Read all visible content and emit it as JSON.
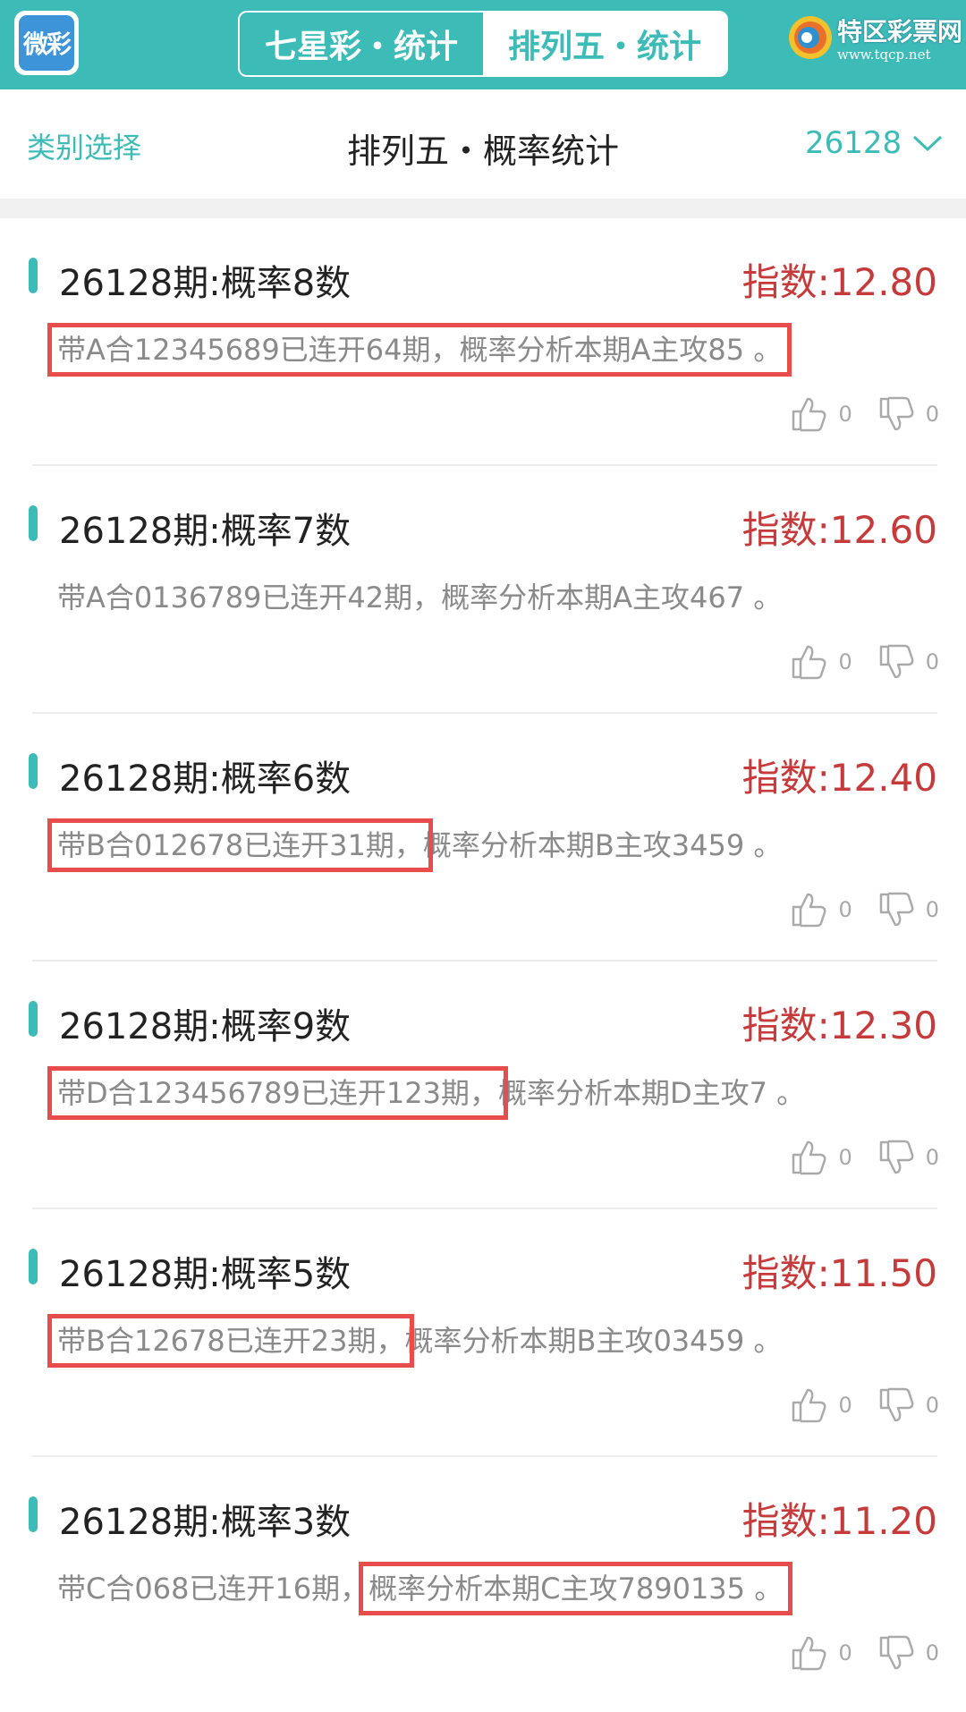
{
  "header": {
    "app_logo_text": "微彩",
    "tabs": [
      {
        "label": "七星彩・统计",
        "active": false
      },
      {
        "label": "排列五・统计",
        "active": true
      }
    ],
    "brand_name": "特区彩票网",
    "brand_url": "www.tqcp.net"
  },
  "subheader": {
    "category_label": "类别选择",
    "title": "排列五・概率统计",
    "period": "26128"
  },
  "colors": {
    "accent": "#3dbbb7",
    "index_red": "#c53a3a",
    "highlight": "#e84c4c"
  },
  "items": [
    {
      "title": "26128期:概率8数",
      "index": "指数:12.80",
      "desc_a": "带A合12345689已连开64期，概率分析本期A主攻85 。",
      "desc_b": "",
      "likes": "0",
      "dislikes": "0"
    },
    {
      "title": "26128期:概率7数",
      "index": "指数:12.60",
      "desc_a": "带A合0136789已连开42期，概率分析本期A主攻467 。",
      "desc_b": "",
      "likes": "0",
      "dislikes": "0"
    },
    {
      "title": "26128期:概率6数",
      "index": "指数:12.40",
      "desc_a": "带B合012678已连开31期，",
      "desc_b": "概率分析本期B主攻3459 。",
      "likes": "0",
      "dislikes": "0"
    },
    {
      "title": "26128期:概率9数",
      "index": "指数:12.30",
      "desc_a": "带D合123456789已连开123期，",
      "desc_b": "概率分析本期D主攻7 。",
      "likes": "0",
      "dislikes": "0"
    },
    {
      "title": "26128期:概率5数",
      "index": "指数:11.50",
      "desc_a": "带B合12678已连开23期，",
      "desc_b": "概率分析本期B主攻03459 。",
      "likes": "0",
      "dislikes": "0"
    },
    {
      "title": "26128期:概率3数",
      "index": "指数:11.20",
      "desc_a": "带C合068已连开16期，",
      "desc_b": "概率分析本期C主攻7890135 。",
      "likes": "0",
      "dislikes": "0"
    }
  ]
}
